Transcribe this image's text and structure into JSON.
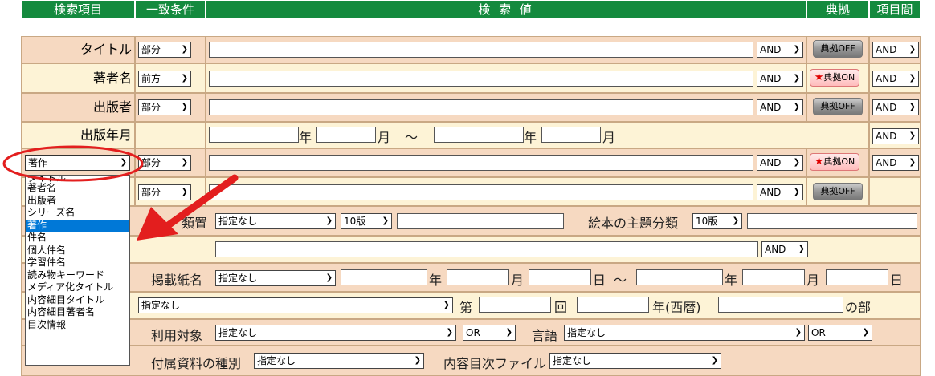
{
  "headers": {
    "field": "検索項目",
    "match": "一致条件",
    "value": "検 索 値",
    "source": "典拠",
    "between": "項目間"
  },
  "rows": {
    "title": {
      "label": "タイトル",
      "match": "部分",
      "op": "AND",
      "source": "典拠OFF",
      "between": "AND"
    },
    "author": {
      "label": "著者名",
      "match": "前方",
      "op": "AND",
      "source": "典拠ON",
      "between": "AND"
    },
    "publisher": {
      "label": "出版者",
      "match": "部分",
      "op": "AND",
      "source": "典拠OFF",
      "between": "AND"
    },
    "date": {
      "label": "出版年月",
      "year": "年",
      "month": "月",
      "tilde": "〜",
      "year2": "年",
      "month2": "月",
      "between": "AND"
    },
    "dynamic": {
      "field": "著作",
      "match": "部分",
      "op": "AND",
      "source": "典拠ON",
      "between": "AND"
    },
    "row6": {
      "match": "部分",
      "op": "AND",
      "source": "典拠OFF"
    }
  },
  "dropdown": {
    "items": [
      "タイトル",
      "著者名",
      "出版者",
      "シリーズ名",
      "著作",
      "件名",
      "個人件名",
      "学習件名",
      "読み物キーワード",
      "メディア化タイトル",
      "内容細目タイトル",
      "内容細目著者名",
      "目次情報"
    ],
    "selected": "著作"
  },
  "lower": {
    "class_label": "類置",
    "class_sel": "指定なし",
    "ed_sel": "10版",
    "theme_label": "絵本の主題分類",
    "theme_ed": "10版",
    "op": "AND",
    "paper_label": "掲載紙名",
    "paper_sel": "指定なし",
    "nen": "年",
    "gatsu": "月",
    "nichi": "日",
    "tilde": "〜",
    "nen2": "年",
    "gatsu2": "月",
    "nichi2": "日",
    "award_sel": "指定なし",
    "dai": "第",
    "kai": "回",
    "year_west": "年(西暦)",
    "nobu": "の部",
    "target_label": "利用対象",
    "target_sel": "指定なし",
    "target_op": "OR",
    "lang_label": "言語",
    "lang_sel": "指定なし",
    "lang_op": "OR",
    "attach_label": "付属資料の種別",
    "attach_sel": "指定なし",
    "toc_label": "内容目次ファイル",
    "toc_sel": "指定なし"
  },
  "colors": {
    "header": "#148a3e",
    "peach": "#f6d9c1",
    "cream": "#fdf3d6",
    "highlight": "#0078d7",
    "annotation": "#e31e1e"
  }
}
